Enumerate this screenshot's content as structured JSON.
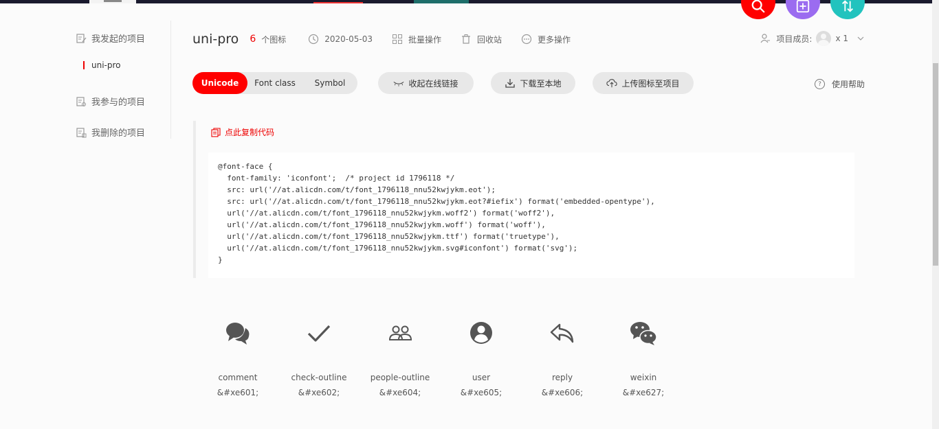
{
  "sidebar": {
    "my_projects": "我发起的项目",
    "current_project": "uni-pro",
    "joined_projects": "我参与的项目",
    "deleted_projects": "我删除的项目"
  },
  "header": {
    "title": "uni-pro",
    "icon_count": "6",
    "icon_count_label": "个图标",
    "date": "2020-05-03",
    "batch": "批量操作",
    "recycle": "回收站",
    "more": "更多操作",
    "members_label": "项目成员:",
    "members_count": "x 1"
  },
  "toolbar": {
    "tabs": [
      "Unicode",
      "Font class",
      "Symbol"
    ],
    "active_tab": "Unicode",
    "collapse_link": "收起在线链接",
    "download": "下载至本地",
    "upload": "上传图标至项目",
    "help": "使用帮助"
  },
  "code": {
    "copy": "点此复制代码",
    "content": "@font-face {\n  font-family: 'iconfont';  /* project id 1796118 */\n  src: url('//at.alicdn.com/t/font_1796118_nnu52kwjykm.eot');\n  src: url('//at.alicdn.com/t/font_1796118_nnu52kwjykm.eot?#iefix') format('embedded-opentype'),\n  url('//at.alicdn.com/t/font_1796118_nnu52kwjykm.woff2') format('woff2'),\n  url('//at.alicdn.com/t/font_1796118_nnu52kwjykm.woff') format('woff'),\n  url('//at.alicdn.com/t/font_1796118_nnu52kwjykm.ttf') format('truetype'),\n  url('//at.alicdn.com/t/font_1796118_nnu52kwjykm.svg#iconfont') format('svg');\n}"
  },
  "icons": [
    {
      "name": "comment",
      "code": "&#xe601;",
      "icon": "comment-icon"
    },
    {
      "name": "check-outline",
      "code": "&#xe602;",
      "icon": "check-outline-icon"
    },
    {
      "name": "people-outline",
      "code": "&#xe604;",
      "icon": "people-outline-icon"
    },
    {
      "name": "user",
      "code": "&#xe605;",
      "icon": "user-icon"
    },
    {
      "name": "reply",
      "code": "&#xe606;",
      "icon": "reply-icon"
    },
    {
      "name": "weixin",
      "code": "&#xe627;",
      "icon": "weixin-icon"
    }
  ],
  "colors": {
    "accent": "#ff0000",
    "fab_search": "#ff0000",
    "fab_add": "#9b6cf0",
    "fab_sort": "#22c3be"
  }
}
